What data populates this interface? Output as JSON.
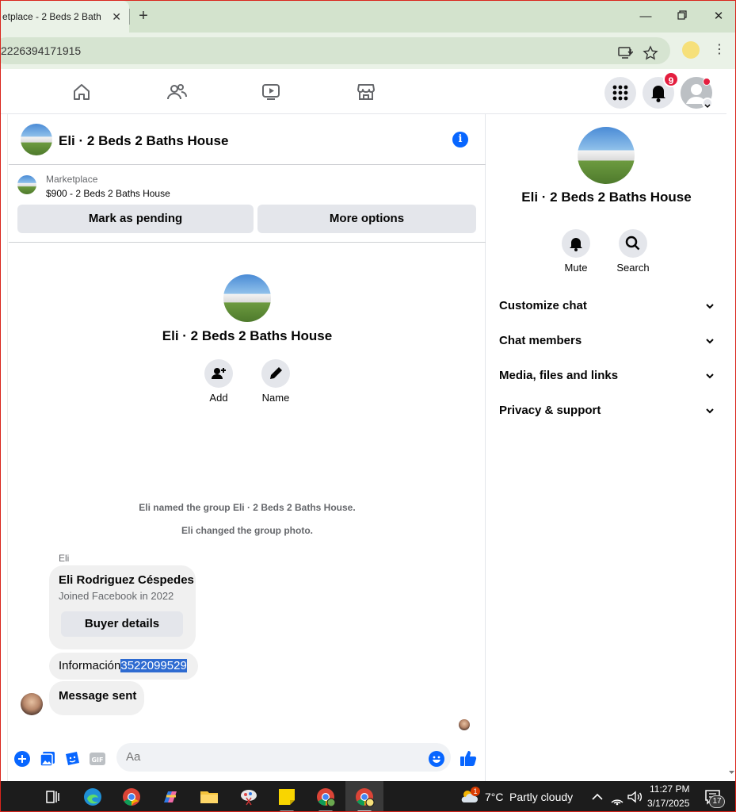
{
  "browser": {
    "tab_title": "etplace - 2 Beds 2 Bath",
    "url": "2226394171915"
  },
  "fb_nav": {
    "notification_count": "9"
  },
  "chat": {
    "header_title": "Eli · 2 Beds 2 Baths House",
    "marketplace": {
      "label": "Marketplace",
      "listing": "$900 - 2 Beds 2 Baths House",
      "mark_pending": "Mark as pending",
      "more_options": "More options"
    },
    "group_title": "Eli · 2 Beds 2 Baths House",
    "actions": {
      "add": "Add",
      "name": "Name"
    },
    "system_messages": [
      "Eli named the group Eli · 2 Beds 2 Baths House.",
      "Eli changed the group photo."
    ],
    "sender": "Eli",
    "buyer_card": {
      "name": "Eli Rodriguez Céspedes",
      "joined": "Joined Facebook in 2022",
      "button": "Buyer details"
    },
    "info_message": {
      "prefix": "Información",
      "highlighted": "3522099529"
    },
    "sent_message": "Message sent",
    "composer_placeholder": "Aa"
  },
  "right_panel": {
    "title": "Eli · 2 Beds 2 Baths House",
    "actions": {
      "mute": "Mute",
      "search": "Search"
    },
    "sections": [
      "Customize chat",
      "Chat members",
      "Media, files and links",
      "Privacy & support"
    ]
  },
  "taskbar": {
    "weather_badge": "1",
    "temperature": "7°C",
    "weather": "Partly cloudy",
    "time": "11:27 PM",
    "date": "3/17/2025",
    "notifications": "17"
  },
  "colors": {
    "accent": "#0866ff",
    "tab_strip": "#d3e3cd",
    "badge": "#e41e3f",
    "selection": "#2e6bd1"
  }
}
